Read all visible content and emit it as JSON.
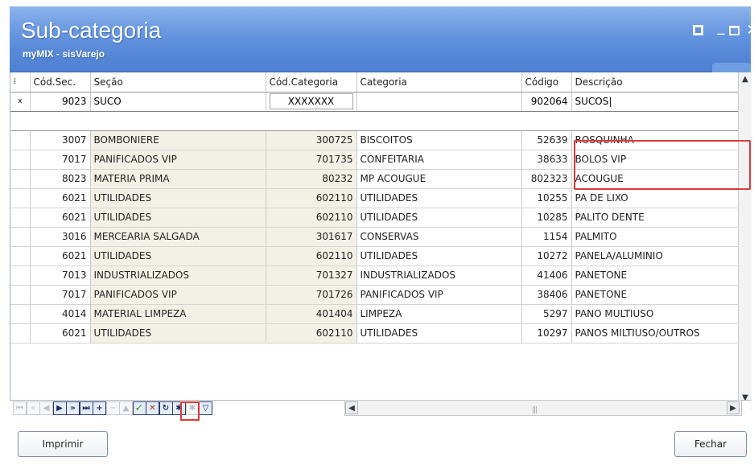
{
  "window": {
    "title": "Sub-categoria",
    "subtitle": "myMIX - sisVarejo"
  },
  "grid": {
    "columns": [
      "Cód.Sec.",
      "Seção",
      "Cód.Categoria",
      "Categoria",
      "Código",
      "Descrição"
    ],
    "filter": {
      "codsec": "9023",
      "secao": "SUCO",
      "codcat": "XXXXXXX",
      "categoria": "",
      "codigo": "902064",
      "descricao": "SUCOS"
    },
    "rows": [
      [
        "3007",
        "BOMBONIERE",
        "300725",
        "BISCOITOS",
        "52639",
        "ROSQUINHA"
      ],
      [
        "7017",
        "PANIFICADOS VIP",
        "701735",
        "CONFEITARIA",
        "38633",
        "BOLOS VIP"
      ],
      [
        "8023",
        "MATERIA PRIMA",
        "80232",
        "MP ACOUGUE",
        "802323",
        "ACOUGUE"
      ],
      [
        "6021",
        "UTILIDADES",
        "602110",
        "UTILIDADES",
        "10255",
        "PA DE LIXO"
      ],
      [
        "6021",
        "UTILIDADES",
        "602110",
        "UTILIDADES",
        "10285",
        "PALITO DENTE"
      ],
      [
        "3016",
        "MERCEARIA SALGADA",
        "301617",
        "CONSERVAS",
        "1154",
        "PALMITO"
      ],
      [
        "6021",
        "UTILIDADES",
        "602110",
        "UTILIDADES",
        "10272",
        "PANELA/ALUMINIO"
      ],
      [
        "7013",
        "INDUSTRIALIZADOS",
        "701327",
        "INDUSTRIALIZADOS",
        "41406",
        "PANETONE"
      ],
      [
        "7017",
        "PANIFICADOS VIP",
        "701726",
        "PANIFICADOS VIP",
        "38406",
        "PANETONE"
      ],
      [
        "4014",
        "MATERIAL LIMPEZA",
        "401404",
        "LIMPEZA",
        "5297",
        "PANO MULTIUSO"
      ],
      [
        "6021",
        "UTILIDADES",
        "602110",
        "UTILIDADES",
        "10297",
        "PANOS MILTIUSO/OUTROS"
      ]
    ]
  },
  "navigator": {
    "buttons": [
      {
        "name": "first",
        "glyph": "⏮"
      },
      {
        "name": "prior-page",
        "glyph": "«"
      },
      {
        "name": "prior",
        "glyph": "◀"
      },
      {
        "name": "next",
        "glyph": "▶"
      },
      {
        "name": "next-page",
        "glyph": "»"
      },
      {
        "name": "last",
        "glyph": "⏭"
      },
      {
        "name": "insert",
        "glyph": "+"
      },
      {
        "name": "delete",
        "glyph": "−"
      },
      {
        "name": "edit",
        "glyph": "▲"
      },
      {
        "name": "post",
        "glyph": "✓"
      },
      {
        "name": "cancel",
        "glyph": "✕"
      },
      {
        "name": "refresh",
        "glyph": "↻"
      },
      {
        "name": "bookmark",
        "glyph": "✱"
      },
      {
        "name": "goto-bookmark",
        "glyph": "✱"
      },
      {
        "name": "filter",
        "glyph": "▽"
      }
    ]
  },
  "footer": {
    "print_label": "Imprimir",
    "close_label": "Fechar"
  }
}
